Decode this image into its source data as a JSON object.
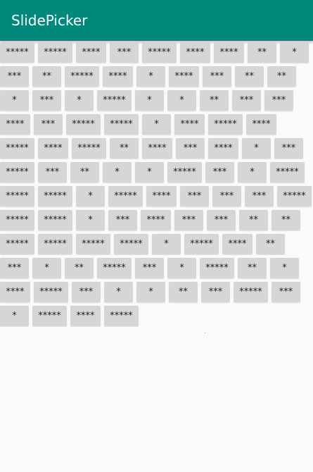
{
  "app": {
    "title": "SlidePicker"
  },
  "grid": {
    "rows": [
      [
        "*****",
        "*****",
        "****",
        "***",
        "*****",
        "****",
        "****",
        "**",
        "*"
      ],
      [
        "***",
        "**",
        "*****",
        "****",
        "*",
        "****",
        "***",
        "**",
        "**"
      ],
      [
        "*",
        "***",
        "*",
        "*****",
        "*",
        "*",
        "**",
        "***",
        "***"
      ],
      [
        "****",
        "***",
        "*****",
        "*****",
        "*",
        "****",
        "*****",
        "****"
      ],
      [
        "*****",
        "****",
        "*****",
        "**",
        "****",
        "***",
        "****",
        "*",
        "***"
      ],
      [
        "*****",
        "***",
        "**",
        "*",
        "*",
        "*****",
        "***",
        "*",
        "*****"
      ],
      [
        "*****",
        "*****",
        "*",
        "*****",
        "****",
        "***",
        "***",
        "***",
        "*****"
      ],
      [
        "*****",
        "*****",
        "*",
        "***",
        "****",
        "***",
        "***",
        "**",
        "**"
      ],
      [
        "*****",
        "*****",
        "*****",
        "*****",
        "*",
        "*****",
        "****",
        "**"
      ],
      [
        "***",
        "*",
        "**",
        "*****",
        "***",
        "*",
        "*****",
        "**",
        "*"
      ],
      [
        "****",
        "*****",
        "***",
        "*",
        "*",
        "**",
        "***",
        "*****",
        "***"
      ],
      [
        "*",
        "*****",
        "****",
        "*****"
      ]
    ]
  }
}
